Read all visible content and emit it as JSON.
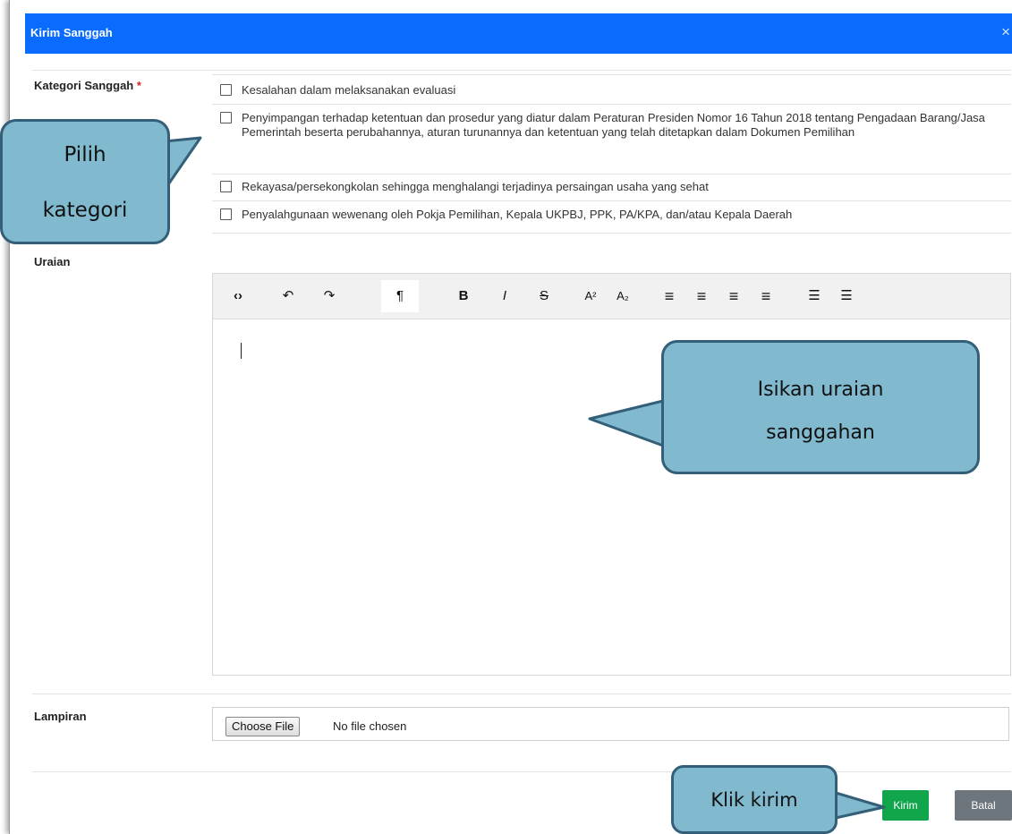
{
  "dialog": {
    "title": "Kirim Sanggah",
    "close_glyph": "×"
  },
  "kategori": {
    "label": "Kategori Sanggah",
    "required_mark": "*",
    "options": [
      "Kesalahan dalam melaksanakan evaluasi",
      "Penyimpangan terhadap ketentuan dan prosedur yang diatur dalam Peraturan Presiden Nomor 16 Tahun 2018 tentang Pengadaan Barang/Jasa Pemerintah beserta perubahannya, aturan turunannya dan ketentuan yang telah ditetapkan dalam Dokumen Pemilihan",
      "Rekayasa/persekongkolan sehingga menghalangi terjadinya persaingan usaha yang sehat",
      "Penyalahgunaan wewenang oleh Pokja Pemilihan, Kepala UKPBJ, PPK, PA/KPA, dan/atau Kepala Daerah"
    ]
  },
  "uraian": {
    "label": "Uraian",
    "toolbar": {
      "code": "‹›",
      "undo": "↶",
      "redo": "↷",
      "paragraph": "¶",
      "bold": "B",
      "italic": "I",
      "strike": "S",
      "superscript": "A²",
      "subscript": "A₂",
      "align_left": "≡",
      "align_center": "≡",
      "align_right": "≡",
      "justify": "≡",
      "bullet_list": "☰",
      "numbered_list": "☰"
    }
  },
  "lampiran": {
    "label": "Lampiran",
    "choose_file": "Choose File",
    "status": "No file chosen"
  },
  "footer": {
    "kirim": "Kirim",
    "batal": "Batal"
  },
  "callouts": {
    "kategori_line1": "Pilih",
    "kategori_line2": "kategori",
    "uraian_line1": "Isikan uraian",
    "uraian_line2": "sanggahan",
    "kirim": "Klik kirim"
  },
  "colors": {
    "header": "#0a6cff",
    "kirim_button": "#12a64c",
    "batal_button": "#6d757d",
    "callout_fill": "#81b9cf",
    "callout_border": "#345f78"
  }
}
